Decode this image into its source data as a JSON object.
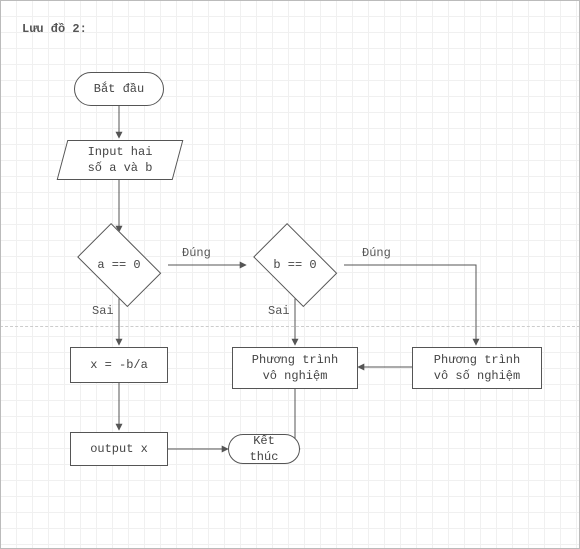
{
  "title": "Lưu đồ 2:",
  "nodes": {
    "start": "Bắt đầu",
    "input_ab": "Input hai\nsố a và b",
    "dec_a": "a == 0",
    "dec_b": "b == 0",
    "calc_x": "x = -b/a",
    "no_solution": "Phương trình\nvô nghiệm",
    "inf_solution": "Phương trình\nvô số nghiệm",
    "output_x": "output x",
    "end": "Kết thúc"
  },
  "labels": {
    "true": "Đúng",
    "false": "Sai"
  },
  "chart_data": {
    "type": "flowchart",
    "title": "Lưu đồ 2",
    "nodes": [
      {
        "id": "start",
        "kind": "terminator",
        "text": "Bắt đầu"
      },
      {
        "id": "input_ab",
        "kind": "io",
        "text": "Input hai số a và b"
      },
      {
        "id": "dec_a",
        "kind": "decision",
        "text": "a == 0"
      },
      {
        "id": "dec_b",
        "kind": "decision",
        "text": "b == 0"
      },
      {
        "id": "calc_x",
        "kind": "process",
        "text": "x = -b/a"
      },
      {
        "id": "no_solution",
        "kind": "process",
        "text": "Phương trình vô nghiệm"
      },
      {
        "id": "inf_solution",
        "kind": "process",
        "text": "Phương trình vô số nghiệm"
      },
      {
        "id": "output_x",
        "kind": "process",
        "text": "output x"
      },
      {
        "id": "end",
        "kind": "terminator",
        "text": "Kết thúc"
      }
    ],
    "edges": [
      {
        "from": "start",
        "to": "input_ab"
      },
      {
        "from": "input_ab",
        "to": "dec_a"
      },
      {
        "from": "dec_a",
        "to": "calc_x",
        "label": "Sai"
      },
      {
        "from": "dec_a",
        "to": "dec_b",
        "label": "Đúng"
      },
      {
        "from": "dec_b",
        "to": "no_solution",
        "label": "Sai"
      },
      {
        "from": "dec_b",
        "to": "inf_solution",
        "label": "Đúng"
      },
      {
        "from": "calc_x",
        "to": "output_x"
      },
      {
        "from": "output_x",
        "to": "end"
      },
      {
        "from": "no_solution",
        "to": "end"
      },
      {
        "from": "inf_solution",
        "to": "no_solution"
      }
    ]
  }
}
